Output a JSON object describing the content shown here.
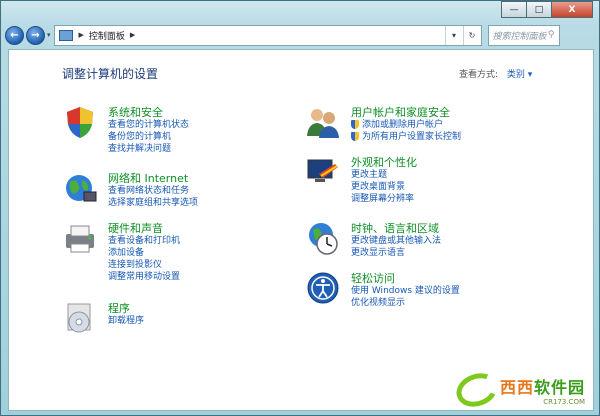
{
  "window_controls": {
    "minimize": "—",
    "maximize": "□",
    "close": "X"
  },
  "nav": {
    "back": "←",
    "forward": "→",
    "dropdown": "▾",
    "breadcrumb": [
      "控制面板"
    ],
    "refresh": "↻",
    "search_placeholder": "搜索控制面板",
    "search_glyph": "⚲"
  },
  "page": {
    "heading": "调整计算机的设置",
    "view_by_label": "查看方式:",
    "view_by_value": "类别 ▾"
  },
  "categories_left": [
    {
      "title": "系统和安全",
      "links": [
        "查看您的计算机状态",
        "备份您的计算机",
        "查找并解决问题"
      ]
    },
    {
      "title": "网络和 Internet",
      "links": [
        "查看网络状态和任务",
        "选择家庭组和共享选项"
      ]
    },
    {
      "title": "硬件和声音",
      "links": [
        "查看设备和打印机",
        "添加设备",
        "连接到投影仪",
        "调整常用移动设置"
      ]
    },
    {
      "title": "程序",
      "links": [
        "卸载程序"
      ]
    }
  ],
  "categories_right": [
    {
      "title": "用户帐户和家庭安全",
      "links": [
        "添加或删除用户帐户",
        "为所有用户设置家长控制"
      ]
    },
    {
      "title": "外观和个性化",
      "links": [
        "更改主题",
        "更改桌面背景",
        "调整屏幕分辨率"
      ]
    },
    {
      "title": "时钟、语言和区域",
      "links": [
        "更改键盘或其他输入法",
        "更改显示语言"
      ]
    },
    {
      "title": "轻松访问",
      "links": [
        "使用 Windows 建议的设置",
        "优化视频显示"
      ]
    }
  ],
  "watermark": {
    "main_a": "西西",
    "main_b": "软件园",
    "sub": "CR173.COM"
  },
  "colors": {
    "link": "#1758b4",
    "category_title": "#0f8f26",
    "heading": "#1d3a7a"
  }
}
